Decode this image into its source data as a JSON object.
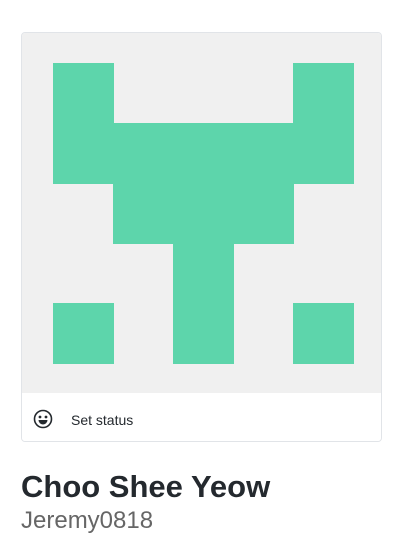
{
  "profile": {
    "avatar_color": "#5dd5ab",
    "avatar_background": "#f0f0f0",
    "status_icon": "smiley-icon",
    "status_label": "Set status",
    "fullname": "Choo Shee Yeow",
    "username": "Jeremy0818"
  }
}
